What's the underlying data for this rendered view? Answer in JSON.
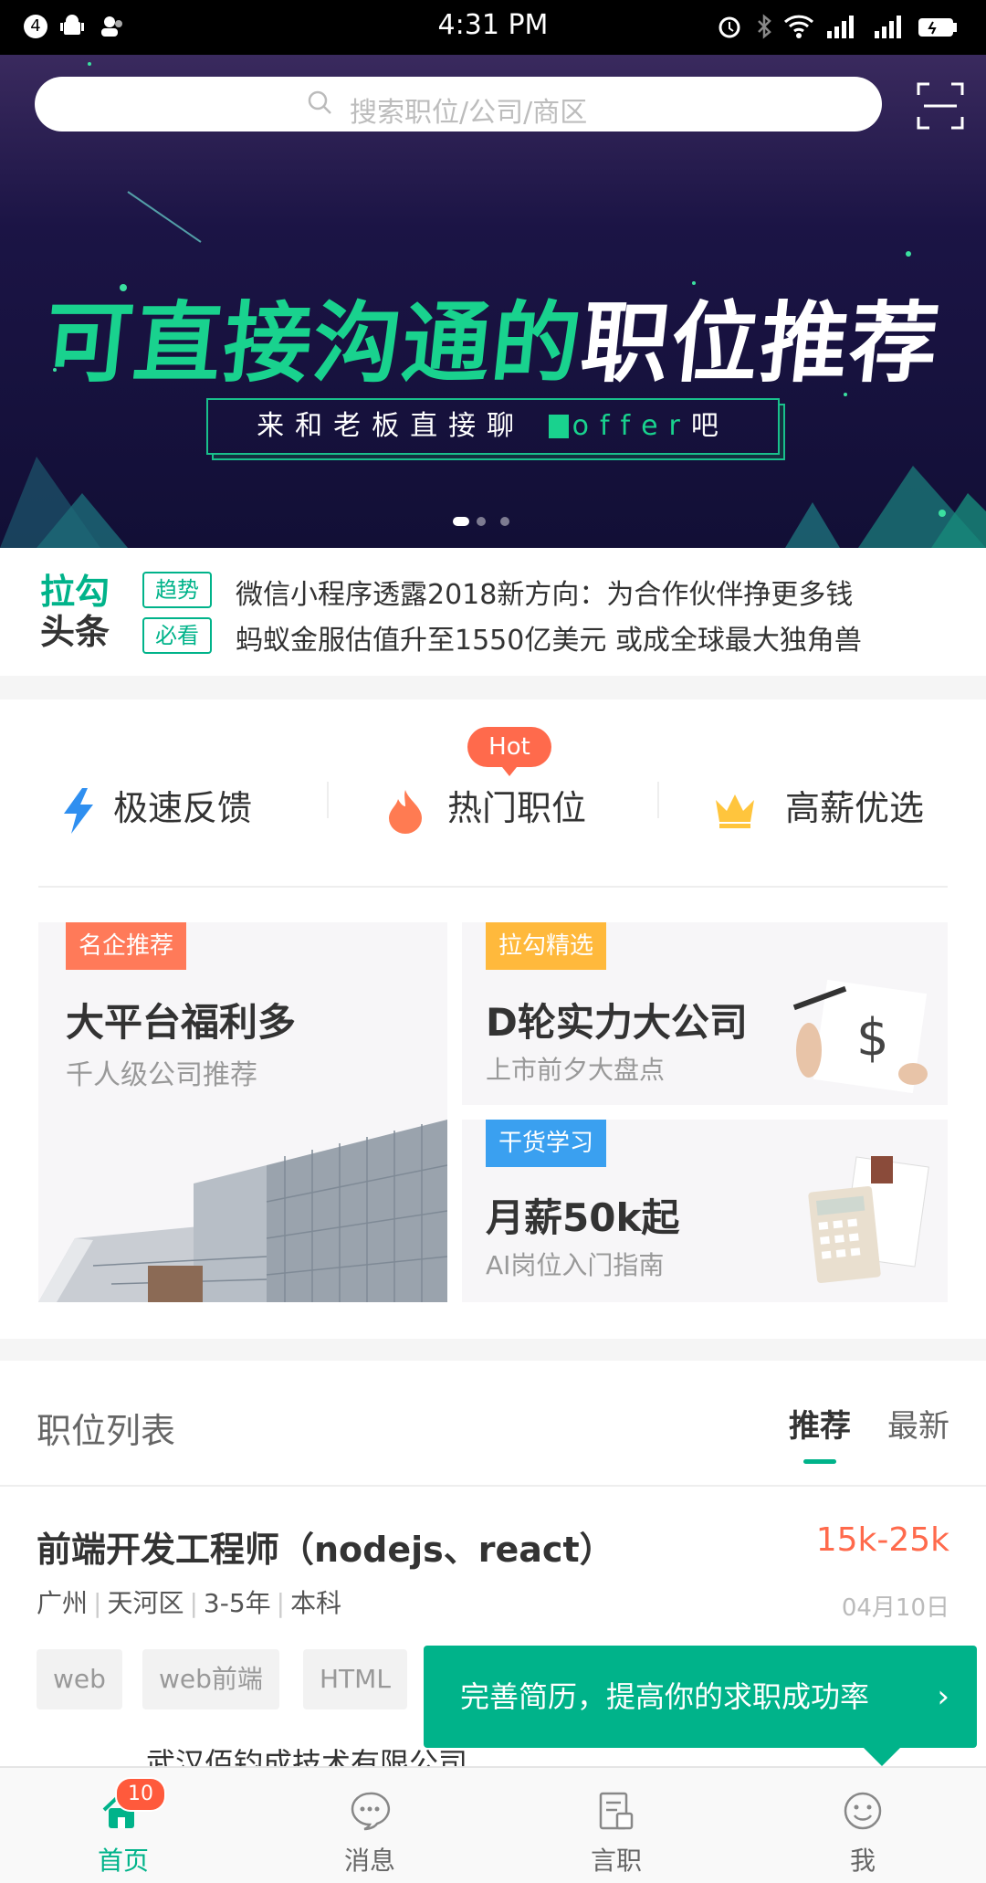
{
  "status_bar": {
    "time": "4:31 PM",
    "left_badge": "4"
  },
  "search": {
    "placeholder": "搜索职位/公司/商区"
  },
  "banner": {
    "title_green": "可直接沟通的",
    "title_white": "职位推荐",
    "subtitle_pre": "来和老板直接聊",
    "subtitle_offer": "offer",
    "subtitle_post": "吧",
    "slides_total": 3,
    "slide_active": 1
  },
  "headlines": {
    "logo_line1": "拉勾",
    "logo_line2": "头条",
    "items": [
      {
        "tag": "趋势",
        "text": "微信小程序透露2018新方向：为合作伙伴挣更多钱"
      },
      {
        "tag": "必看",
        "text": "蚂蚁金服估值升至1550亿美元 或成全球最大独角兽"
      }
    ]
  },
  "quick_entries": {
    "items": [
      {
        "label": "极速反馈",
        "icon": "lightning-icon"
      },
      {
        "label": "热门职位",
        "icon": "flame-icon"
      },
      {
        "label": "高薪优选",
        "icon": "crown-icon"
      }
    ],
    "hot_badge": "Hot"
  },
  "cards": [
    {
      "tag": "名企推荐",
      "title": "大平台福利多",
      "subtitle": "千人级公司推荐",
      "tag_color": "#ff7a59"
    },
    {
      "tag": "拉勾精选",
      "title": "D轮实力大公司",
      "subtitle": "上市前夕大盘点",
      "tag_color": "#ffb93c"
    },
    {
      "tag": "干货学习",
      "title": "月薪50k起",
      "subtitle": "AI岗位入门指南",
      "tag_color": "#3aa0f0"
    }
  ],
  "job_list": {
    "title": "职位列表",
    "tabs": [
      "推荐",
      "最新"
    ],
    "active_tab": "推荐",
    "jobs": [
      {
        "title": "前端开发工程师（nodejs、react）",
        "salary": "15k-25k",
        "city": "广州",
        "district": "天河区",
        "experience": "3-5年",
        "education": "本科",
        "date": "04月10日",
        "tags": [
          "web",
          "web前端",
          "HTML"
        ],
        "company": "武汉佰钧成技术有限公司"
      }
    ]
  },
  "toast": {
    "text": "完善简历，提高你的求职成功率",
    "arrow": "›"
  },
  "bottom_nav": {
    "items": [
      {
        "label": "首页",
        "icon": "home-icon",
        "active": true
      },
      {
        "label": "消息",
        "icon": "message-icon",
        "active": false
      },
      {
        "label": "言职",
        "icon": "article-icon",
        "active": false
      },
      {
        "label": "我",
        "icon": "profile-icon",
        "active": false
      }
    ],
    "badge": "10"
  },
  "colors": {
    "brand_green": "#00b38a",
    "accent_orange": "#ff6a4c"
  }
}
